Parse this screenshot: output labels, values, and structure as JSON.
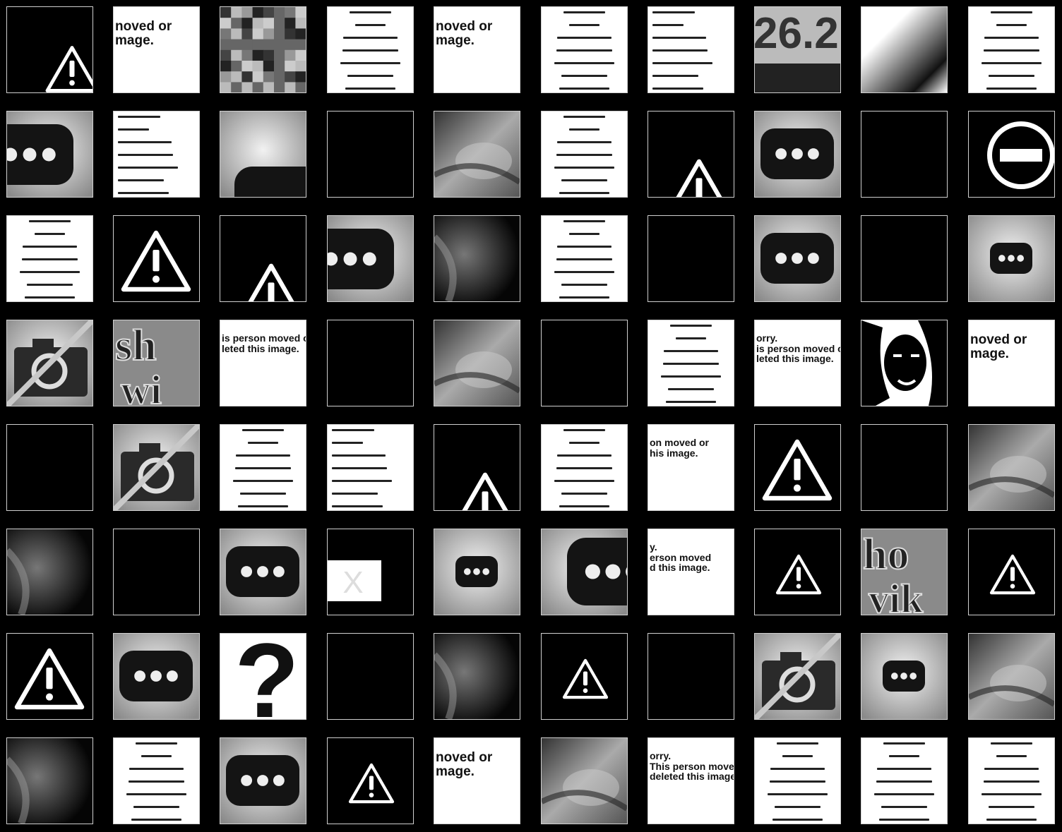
{
  "grid": {
    "cols": 10,
    "rows": 8,
    "tiles": [
      {
        "kind": "warn-corner",
        "text": ""
      },
      {
        "kind": "text-crop",
        "text": "noved or\nmage."
      },
      {
        "kind": "pixel",
        "text": ""
      },
      {
        "kind": "doc-lines",
        "text": ""
      },
      {
        "kind": "text-crop",
        "text": "noved or\nmage."
      },
      {
        "kind": "doc-lines",
        "text": ""
      },
      {
        "kind": "doc-lines-left",
        "text": ""
      },
      {
        "kind": "number-crop",
        "text": "26.2"
      },
      {
        "kind": "gradient",
        "text": ""
      },
      {
        "kind": "doc-lines",
        "text": ""
      },
      {
        "kind": "ellipsis-left",
        "text": ""
      },
      {
        "kind": "doc-lines-left",
        "text": ""
      },
      {
        "kind": "bubble-corner",
        "text": ""
      },
      {
        "kind": "black",
        "text": ""
      },
      {
        "kind": "photo",
        "text": ""
      },
      {
        "kind": "doc-lines",
        "text": ""
      },
      {
        "kind": "warn-bottom",
        "text": ""
      },
      {
        "kind": "ellipsis",
        "text": ""
      },
      {
        "kind": "black",
        "text": ""
      },
      {
        "kind": "no-entry",
        "text": ""
      },
      {
        "kind": "doc-lines",
        "text": ""
      },
      {
        "kind": "warn",
        "text": ""
      },
      {
        "kind": "warn-bottom",
        "text": ""
      },
      {
        "kind": "ellipsis-left",
        "text": ""
      },
      {
        "kind": "photo-dark",
        "text": ""
      },
      {
        "kind": "doc-lines",
        "text": ""
      },
      {
        "kind": "black",
        "text": ""
      },
      {
        "kind": "ellipsis",
        "text": ""
      },
      {
        "kind": "black",
        "text": ""
      },
      {
        "kind": "ellipsis-small",
        "text": ""
      },
      {
        "kind": "camera",
        "text": ""
      },
      {
        "kind": "logo-crop",
        "text": "sh\nwi"
      },
      {
        "kind": "text-crop",
        "text": "is person moved or\nleted this image."
      },
      {
        "kind": "black",
        "text": ""
      },
      {
        "kind": "photo",
        "text": ""
      },
      {
        "kind": "black",
        "text": ""
      },
      {
        "kind": "doc-lines",
        "text": ""
      },
      {
        "kind": "text-crop",
        "text": "orry.\nis person moved or\nleted this image."
      },
      {
        "kind": "portrait",
        "text": ""
      },
      {
        "kind": "text-crop",
        "text": "noved or\nmage."
      },
      {
        "kind": "black",
        "text": ""
      },
      {
        "kind": "camera",
        "text": ""
      },
      {
        "kind": "doc-lines",
        "text": ""
      },
      {
        "kind": "doc-lines-left",
        "text": ""
      },
      {
        "kind": "warn-bottom",
        "text": ""
      },
      {
        "kind": "doc-lines",
        "text": ""
      },
      {
        "kind": "text-crop",
        "text": "on moved or\nhis image."
      },
      {
        "kind": "warn",
        "text": ""
      },
      {
        "kind": "black",
        "text": ""
      },
      {
        "kind": "photo",
        "text": ""
      },
      {
        "kind": "photo-dark",
        "text": ""
      },
      {
        "kind": "black",
        "text": ""
      },
      {
        "kind": "ellipsis",
        "text": ""
      },
      {
        "kind": "x-box",
        "text": "X"
      },
      {
        "kind": "ellipsis-small",
        "text": ""
      },
      {
        "kind": "ellipsis-right",
        "text": ""
      },
      {
        "kind": "text-crop",
        "text": "y.\nerson moved\nd this image."
      },
      {
        "kind": "warn-small",
        "text": ""
      },
      {
        "kind": "logo-crop",
        "text": "ho\nvik"
      },
      {
        "kind": "warn-small",
        "text": ""
      },
      {
        "kind": "warn",
        "text": ""
      },
      {
        "kind": "ellipsis",
        "text": ""
      },
      {
        "kind": "question",
        "text": "?"
      },
      {
        "kind": "black",
        "text": ""
      },
      {
        "kind": "photo-dark",
        "text": ""
      },
      {
        "kind": "warn-small",
        "text": ""
      },
      {
        "kind": "black",
        "text": ""
      },
      {
        "kind": "camera",
        "text": ""
      },
      {
        "kind": "ellipsis-small",
        "text": ""
      },
      {
        "kind": "photo",
        "text": ""
      },
      {
        "kind": "photo-dark",
        "text": ""
      },
      {
        "kind": "doc-lines",
        "text": ""
      },
      {
        "kind": "ellipsis",
        "text": ""
      },
      {
        "kind": "warn-small",
        "text": ""
      },
      {
        "kind": "text-crop",
        "text": "noved or\nmage."
      },
      {
        "kind": "photo",
        "text": ""
      },
      {
        "kind": "text-crop",
        "text": "orry.\nThis person moved or\ndeleted this image."
      },
      {
        "kind": "doc-lines",
        "text": ""
      },
      {
        "kind": "doc-lines",
        "text": ""
      },
      {
        "kind": "doc-lines",
        "text": ""
      }
    ]
  }
}
